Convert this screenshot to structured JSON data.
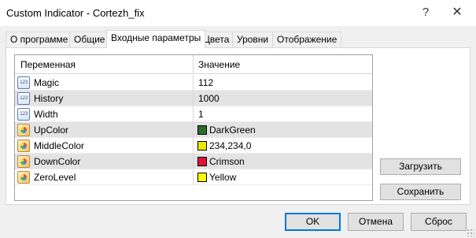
{
  "window": {
    "title": "Custom Indicator - Cortezh_fix",
    "help_glyph": "?",
    "close_glyph": "✕"
  },
  "tabs": [
    {
      "label": "О программе",
      "active": false
    },
    {
      "label": "Общие",
      "active": false
    },
    {
      "label": "Входные параметры",
      "active": true
    },
    {
      "label": "Цвета",
      "active": false
    },
    {
      "label": "Уровни",
      "active": false
    },
    {
      "label": "Отображение",
      "active": false
    }
  ],
  "grid": {
    "col_variable": "Переменная",
    "col_value": "Значение",
    "rows": [
      {
        "name": "Magic",
        "value": "112",
        "icon": "number-icon",
        "swatch": null,
        "shaded": false
      },
      {
        "name": "History",
        "value": "1000",
        "icon": "number-icon",
        "swatch": null,
        "shaded": true
      },
      {
        "name": "Width",
        "value": "1",
        "icon": "number-icon",
        "swatch": null,
        "shaded": false
      },
      {
        "name": "UpColor",
        "value": "DarkGreen",
        "icon": "palette-icon",
        "swatch": "#2e6b2e",
        "shaded": true
      },
      {
        "name": "MiddleColor",
        "value": "234,234,0",
        "icon": "palette-icon",
        "swatch": "#eaea00",
        "shaded": false
      },
      {
        "name": "DownColor",
        "value": "Crimson",
        "icon": "palette-icon",
        "swatch": "#dc143c",
        "shaded": true
      },
      {
        "name": "ZeroLevel",
        "value": "Yellow",
        "icon": "palette-icon",
        "swatch": "#ffff00",
        "shaded": false
      }
    ]
  },
  "side_buttons": {
    "load": "Загрузить",
    "save": "Сохранить"
  },
  "bottom_buttons": {
    "ok": "OK",
    "cancel": "Отмена",
    "reset": "Сброс"
  },
  "colors": {
    "accent_focus": "#0078d7",
    "row_shade": "#e3e3e3"
  }
}
